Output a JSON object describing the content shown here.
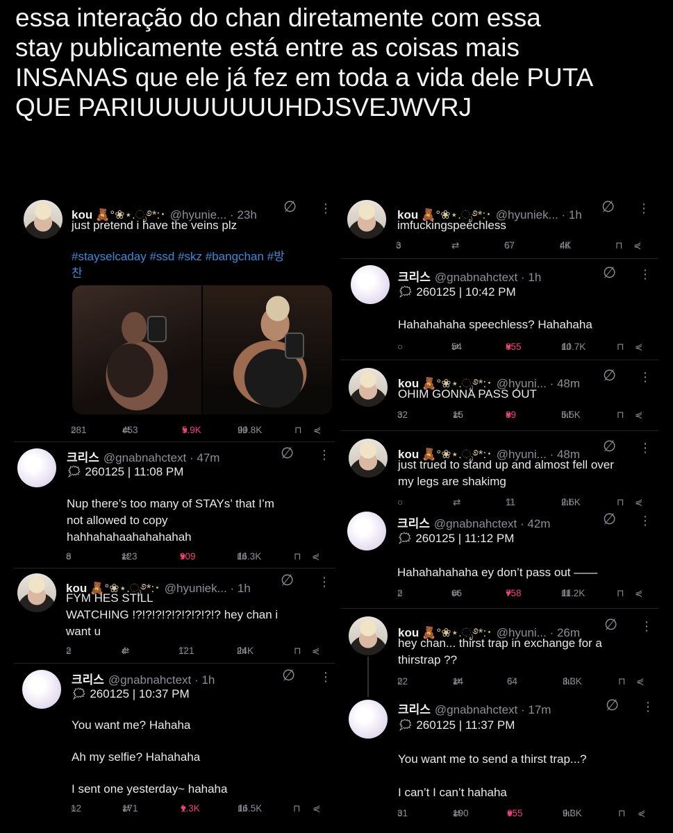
{
  "caption": {
    "lines": [
      "essa interação do chan diretamente com essa",
      "stay publicamente está entre as coisas mais",
      "INSANAS que ele já fez em toda a vida dele PUTA",
      "QUE PARIUUUUUUUUHDJSVEJWVRJ"
    ]
  },
  "icons": {
    "reply": "○",
    "retweet": "⇄",
    "like_outline": "♡",
    "like_filled": "♥",
    "views": "ılıl",
    "bookmark": "⊓",
    "share": "⋞",
    "no_follow": "∅",
    "more": "⋮",
    "calendar": "🗯"
  },
  "tweets": {
    "l1": {
      "name": "kou",
      "deco": "🧸°❀⋆.ೃ࿔*:･",
      "handle": "@hyunie...",
      "time": "· 23h",
      "text": [
        "just pretend i have the veins plz"
      ],
      "hashtags": [
        "#stayselcaday #ssd #skz #bangchan #방",
        "찬"
      ],
      "stats": {
        "replies": "281",
        "retweets": "453",
        "likes": "5.9K",
        "views": "99.8K"
      }
    },
    "l2": {
      "name": "크리스",
      "handle": "@gnabnahctext · 47m",
      "date": "260125 | 11:08 PM",
      "text": [
        "Nup there’s too many of STAYs’ that I’m",
        "not allowed to copy",
        "hahhahahaahahahahah"
      ],
      "stats": {
        "replies": "8",
        "retweets": "123",
        "likes": "909",
        "views": "16.3K"
      }
    },
    "l3": {
      "name": "kou",
      "deco": "🧸°❀⋆.ೃ࿔*:･",
      "handle": "@hyuniek...",
      "time": "· 1h",
      "text": [
        "FYM HES STILL",
        "WATCHING !?!?!?!?!?!?!?!?!? hey chan i",
        "want u"
      ],
      "stats": {
        "replies": "2",
        "retweets": "4",
        "likes": "121",
        "views": "24K"
      }
    },
    "l4": {
      "name": "크리스",
      "handle": "@gnabnahctext · 1h",
      "date": "260125 | 10:37 PM",
      "text": [
        "You want me? Hahaha",
        "Ah my selfie? Hahahaha",
        "I sent one yesterday~ hahaha"
      ],
      "stats": {
        "replies": "12",
        "retweets": "171",
        "likes": "1.3K",
        "views": "16.5K"
      }
    },
    "r1": {
      "name": "kou",
      "deco": "🧸°❀⋆.ೃ࿔*:･",
      "handle": "@hyuniek...",
      "time": "· 1h",
      "text": [
        "imfuckingspeechless"
      ],
      "stats": {
        "replies": "3",
        "retweets": "",
        "likes": "67",
        "views": "4K"
      }
    },
    "r2": {
      "name": "크리스",
      "handle": "@gnabnahctext · 1h",
      "date": "260125 | 10:42 PM",
      "text": [
        "Hahahahaha speechless? Hahahaha"
      ],
      "stats": {
        "replies": "",
        "retweets": "54",
        "likes": "855",
        "views": "10.7K"
      }
    },
    "r3": {
      "name": "kou",
      "deco": "🧸°❀⋆.ೃ࿔*:･",
      "handle": "@hyuni...",
      "time": "· 48m",
      "text": [
        "OHIM GONNA PASS OUT"
      ],
      "stats": {
        "replies": "32",
        "retweets": "15",
        "likes": "89",
        "views": "5.5K"
      }
    },
    "r4": {
      "name": "kou",
      "deco": "🧸°❀⋆.ೃ࿔*:･",
      "handle": "@hyuni...",
      "time": "· 48m",
      "text": [
        "just trued to stand up and almost fell over",
        "my legs are shakimg"
      ],
      "stats": {
        "replies": "",
        "retweets": "",
        "likes": "11",
        "views": "2.6K"
      }
    },
    "r5": {
      "name": "크리스",
      "handle": "@gnabnahctext · 42m",
      "date": "260125 | 11:12 PM",
      "text": [
        "Hahahahahaha ey don’t pass out ——"
      ],
      "stats": {
        "replies": "2",
        "retweets": "66",
        "likes": "758",
        "views": "11.2K"
      }
    },
    "r6": {
      "name": "kou",
      "deco": "🧸°❀⋆.ೃ࿔*:･",
      "handle": "@hyuni...",
      "time": "· 26m",
      "text": [
        "hey chan... thirst trap in exchange for a",
        "thirstrap ??"
      ],
      "stats": {
        "replies": "22",
        "retweets": "14",
        "likes": "64",
        "views": "3.3K"
      }
    },
    "r7": {
      "name": "크리스",
      "handle": "@gnabnahctext · 17m",
      "date": "260125 | 11:37 PM",
      "text": [
        "You want me to send a thirst trap...?",
        "I can’t I can’t hahaha"
      ],
      "stats": {
        "replies": "31",
        "retweets": "190",
        "likes": "655",
        "views": "9.3K"
      }
    }
  },
  "colors": {
    "like_active": "#f0427f",
    "hashtag": "#3b8bd9",
    "muted": "#8b9096"
  }
}
